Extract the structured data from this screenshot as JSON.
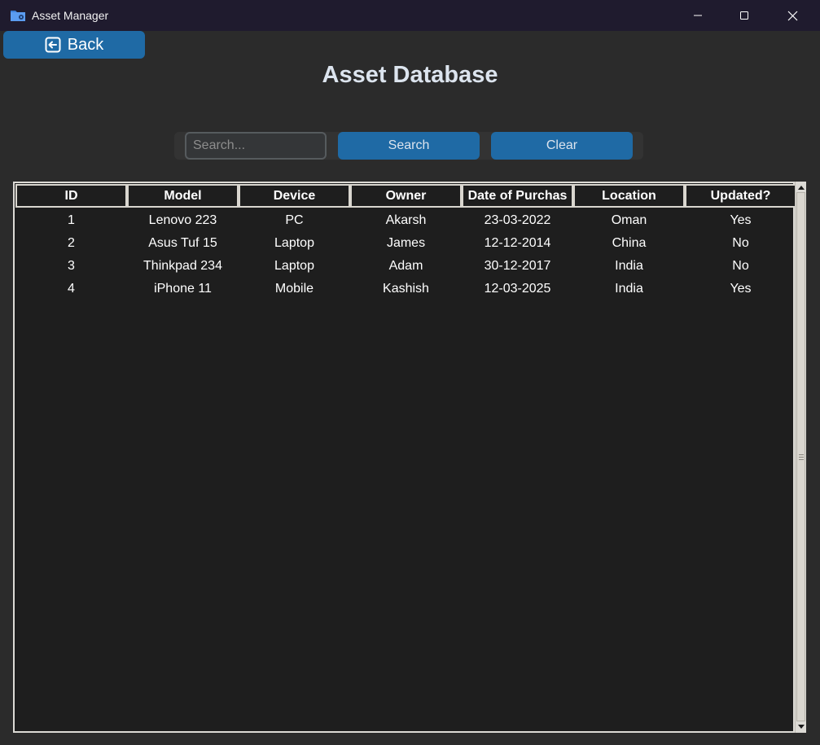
{
  "window": {
    "title": "Asset Manager",
    "app_icon": "folder-gear-icon",
    "controls": [
      "minimize-icon",
      "maximize-icon",
      "close-icon"
    ]
  },
  "back_button": {
    "label": "Back",
    "icon": "arrow-left-box-icon"
  },
  "page_title": "Asset Database",
  "search": {
    "placeholder": "Search...",
    "value": "",
    "search_label": "Search",
    "clear_label": "Clear"
  },
  "table": {
    "columns": [
      "ID",
      "Model",
      "Device",
      "Owner",
      "Date of Purchas",
      "Location",
      "Updated?"
    ],
    "rows": [
      [
        "1",
        "Lenovo 223",
        "PC",
        "Akarsh",
        "23-03-2022",
        "Oman",
        "Yes"
      ],
      [
        "2",
        "Asus Tuf 15",
        "Laptop",
        "James",
        "12-12-2014",
        "China",
        "No"
      ],
      [
        "3",
        "Thinkpad 234",
        "Laptop",
        "Adam",
        "30-12-2017",
        "India",
        "No"
      ],
      [
        "4",
        "iPhone 11",
        "Mobile",
        "Kashish",
        "12-03-2025",
        "India",
        "Yes"
      ]
    ]
  },
  "colors": {
    "titlebar": "#1f1b2e",
    "background": "#2b2b2b",
    "accent": "#1f6aa5",
    "table_bg": "#1e1e1e"
  }
}
